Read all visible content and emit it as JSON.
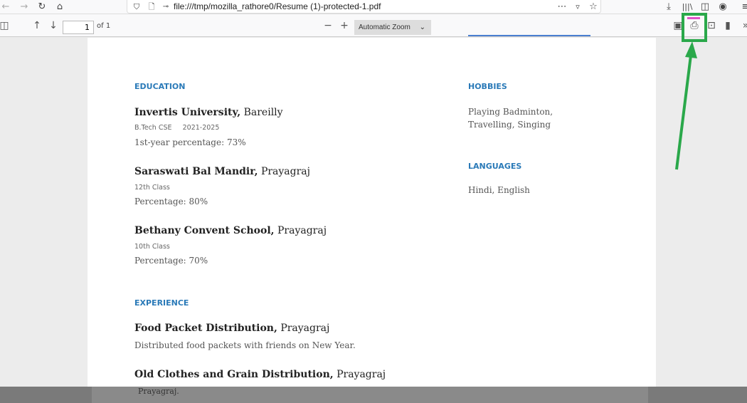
{
  "browser": {
    "url": "file:///tmp/mozilla_rathore0/Resume (1)-protected-1.pdf"
  },
  "pdf_toolbar": {
    "page_number": "1",
    "page_of": "of 1",
    "zoom": "Automatic Zoom"
  },
  "resume": {
    "education_heading": "EDUCATION",
    "education": [
      {
        "school": "Invertis University,",
        "place": "Bareilly",
        "meta": "B.Tech CSE     2021-2025",
        "detail": "1st-year percentage: 73%"
      },
      {
        "school": "Saraswati Bal Mandir,",
        "place": "Prayagraj",
        "meta": "12th Class",
        "detail": "Percentage: 80%"
      },
      {
        "school": "Bethany Convent School,",
        "place": "Prayagraj",
        "meta": "10th Class",
        "detail": "Percentage: 70%"
      }
    ],
    "experience_heading": "EXPERIENCE",
    "experience": [
      {
        "title": "Food Packet Distribution,",
        "place": "Prayagraj",
        "detail": "Distributed food packets with friends on New Year."
      },
      {
        "title": "Old Clothes and Grain Distribution,",
        "place": "Prayagraj"
      }
    ],
    "hobbies_heading": "HOBBIES",
    "hobbies_line1": "Playing Badminton,",
    "hobbies_line2": "Travelling, Singing",
    "languages_heading": "LANGUAGES",
    "languages": "Hindi, English"
  },
  "dimmed_text": "Prayagraj.",
  "annotation_color": "#2aa84a"
}
